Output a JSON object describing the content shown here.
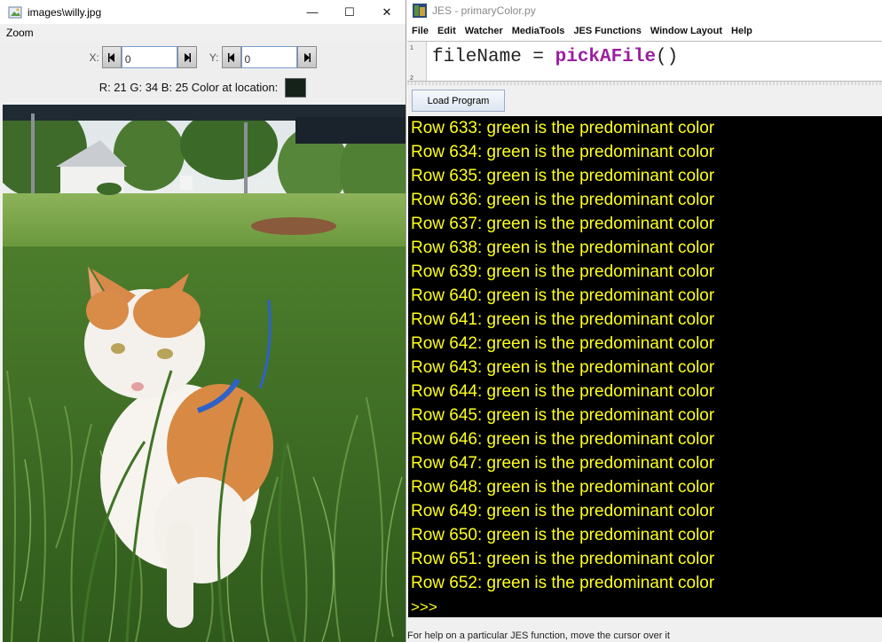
{
  "viewer": {
    "title": "images\\willy.jpg",
    "menu": {
      "zoom": "Zoom"
    },
    "x_label": "X:",
    "x_value": "0",
    "y_label": "Y:",
    "y_value": "0",
    "color_info": "R: 21 G: 34 B: 25 Color at location:",
    "swatch_color": "#152219",
    "window_controls": {
      "minimize": "—",
      "maximize": "☐",
      "close": "✕"
    }
  },
  "jes": {
    "title": "JES - primaryColor.py",
    "menu": {
      "file": "File",
      "edit": "Edit",
      "watcher": "Watcher",
      "mediatools": "MediaTools",
      "jes_functions": "JES Functions",
      "window_layout": "Window Layout",
      "help": "Help"
    },
    "editor": {
      "line_numbers": [
        "1",
        "2"
      ],
      "code_var": "fileName = ",
      "code_fn": "pickAFile",
      "code_end": "()"
    },
    "load_button": "Load Program",
    "console_lines": [
      "Row 633: green is the predominant color",
      "Row 634: green is the predominant color",
      "Row 635: green is the predominant color",
      "Row 636: green is the predominant color",
      "Row 637: green is the predominant color",
      "Row 638: green is the predominant color",
      "Row 639: green is the predominant color",
      "Row 640: green is the predominant color",
      "Row 641: green is the predominant color",
      "Row 642: green is the predominant color",
      "Row 643: green is the predominant color",
      "Row 644: green is the predominant color",
      "Row 645: green is the predominant color",
      "Row 646: green is the predominant color",
      "Row 647: green is the predominant color",
      "Row 648: green is the predominant color",
      "Row 649: green is the predominant color",
      "Row 650: green is the predominant color",
      "Row 651: green is the predominant color",
      "Row 652: green is the predominant color"
    ],
    "prompt": ">>>",
    "status": "For help on a particular JES function, move the cursor over it"
  }
}
